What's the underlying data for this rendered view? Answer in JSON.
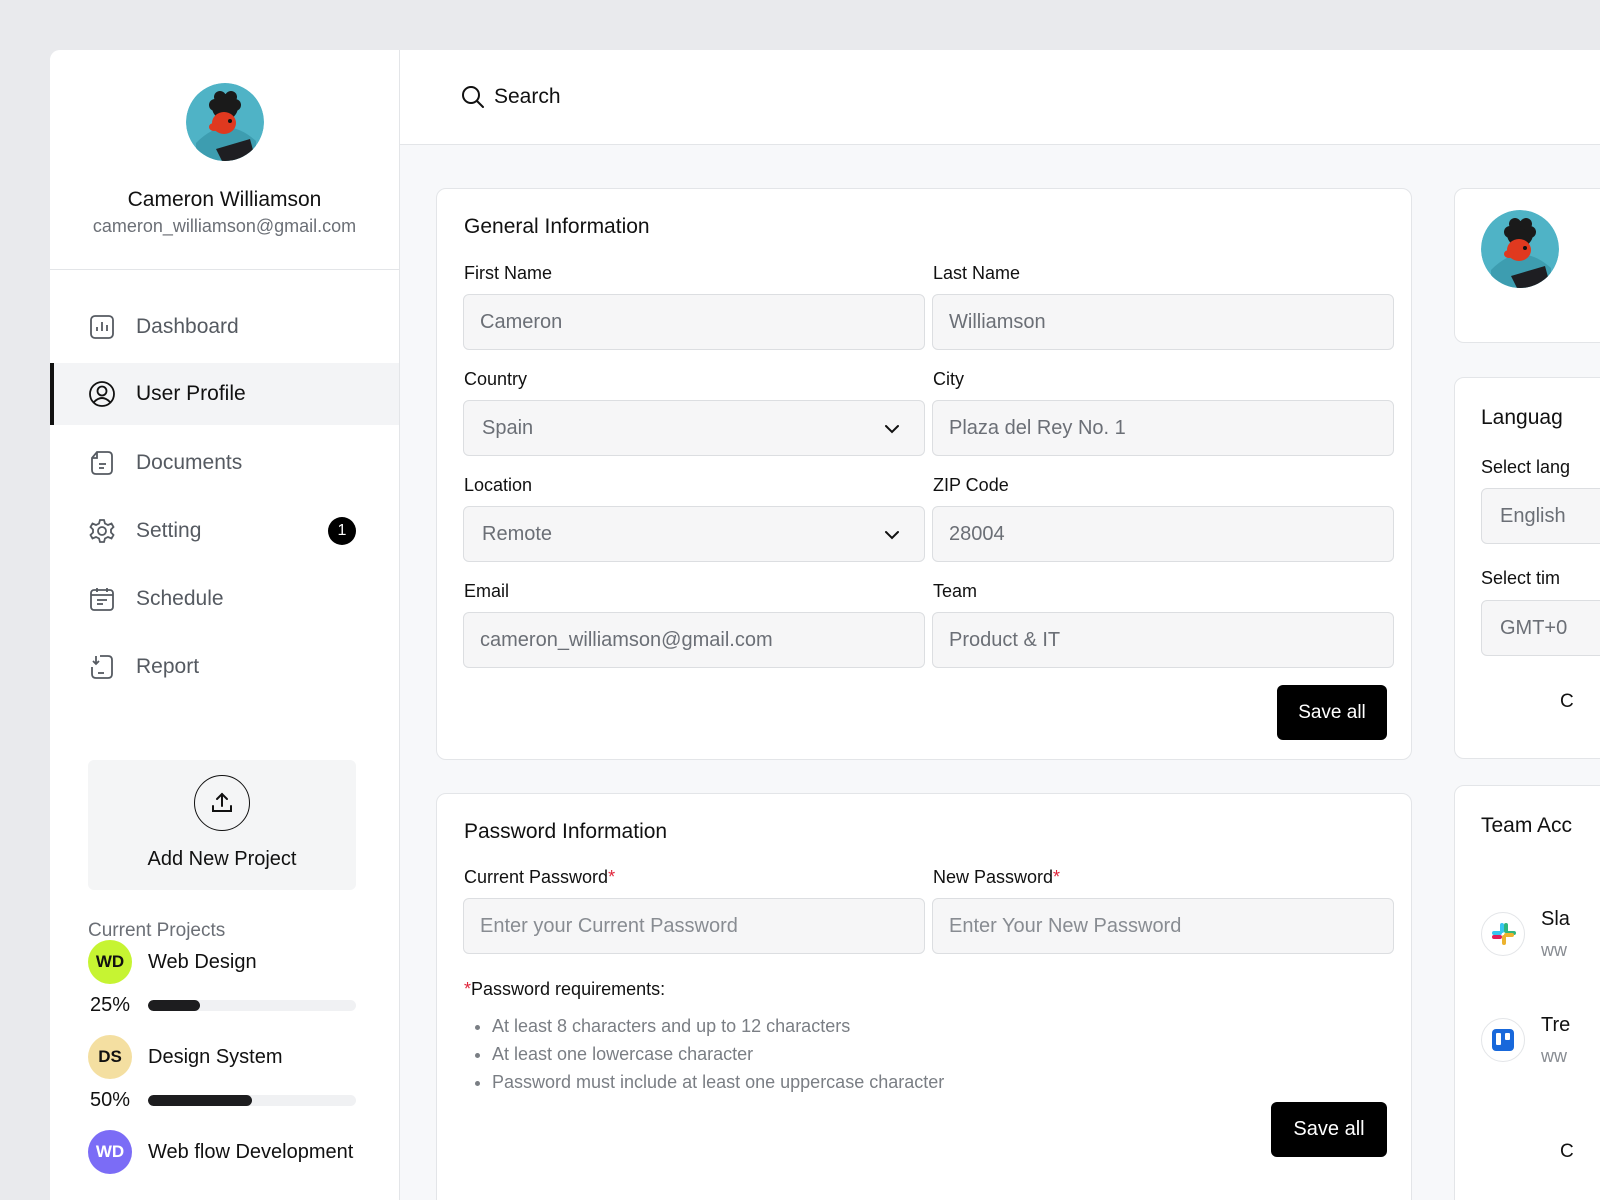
{
  "user": {
    "name": "Cameron Williamson",
    "email": "cameron_williamson@gmail.com"
  },
  "nav": [
    {
      "label": "Dashboard",
      "icon": "dashboard-icon"
    },
    {
      "label": "User Profile",
      "icon": "user-profile-icon",
      "active": true
    },
    {
      "label": "Documents",
      "icon": "documents-icon"
    },
    {
      "label": "Setting",
      "icon": "gear-icon",
      "badge": "1"
    },
    {
      "label": "Schedule",
      "icon": "calendar-icon"
    },
    {
      "label": "Report",
      "icon": "report-icon"
    }
  ],
  "add_project": {
    "label": "Add New Project",
    "icon": "upload-icon"
  },
  "current_projects": {
    "title": "Current Projects",
    "items": [
      {
        "initials": "WD",
        "name": "Web Design",
        "percent": "25%",
        "progress": 0.25,
        "color": "#c6f432"
      },
      {
        "initials": "DS",
        "name": "Design System",
        "percent": "50%",
        "progress": 0.5,
        "color": "#f4dfa1"
      },
      {
        "initials": "WD",
        "name": "Web flow Development",
        "color": "#7b6cf6"
      }
    ]
  },
  "search": {
    "placeholder": "Search",
    "icon": "search-icon"
  },
  "general": {
    "title": "General Information",
    "first_name": {
      "label": "First Name",
      "value": "Cameron"
    },
    "last_name": {
      "label": "Last Name",
      "value": "Williamson"
    },
    "country": {
      "label": "Country",
      "value": "Spain"
    },
    "city": {
      "label": "City",
      "value": "Plaza del Rey No. 1"
    },
    "location": {
      "label": "Location",
      "value": "Remote"
    },
    "zip": {
      "label": "ZIP Code",
      "value": "28004"
    },
    "email": {
      "label": "Email",
      "value": "cameron_williamson@gmail.com"
    },
    "team": {
      "label": "Team",
      "value": "Product & IT"
    },
    "save_label": "Save all"
  },
  "password": {
    "title": "Password Information",
    "current": {
      "label": "Current Password",
      "placeholder": "Enter your Current Password"
    },
    "new": {
      "label": "New Password",
      "placeholder": "Enter Your New Password"
    },
    "required_mark": "*",
    "requirements_title": "Password requirements:",
    "requirements": [
      "At least 8 characters and up to 12 characters",
      "At least one lowercase character",
      "Password must include at least one uppercase character"
    ],
    "save_label": "Save all"
  },
  "right_panel": {
    "language_title": "Languag",
    "select_language_label": "Select lang",
    "language_value": "English",
    "select_timezone_label": "Select tim",
    "timezone_value": "GMT+0",
    "language_footer": "C",
    "team_title": "Team Acc",
    "apps": [
      {
        "name": "Sla",
        "url": "ww",
        "icon": "slack-icon"
      },
      {
        "name": "Tre",
        "url": "ww",
        "icon": "trello-icon"
      }
    ],
    "team_footer": "C"
  },
  "colors": {
    "accent": "#000000",
    "required": "#e0243a",
    "wd_badge": "#c6f432",
    "ds_badge": "#f4dfa1",
    "wfd_badge": "#7b6cf6"
  }
}
